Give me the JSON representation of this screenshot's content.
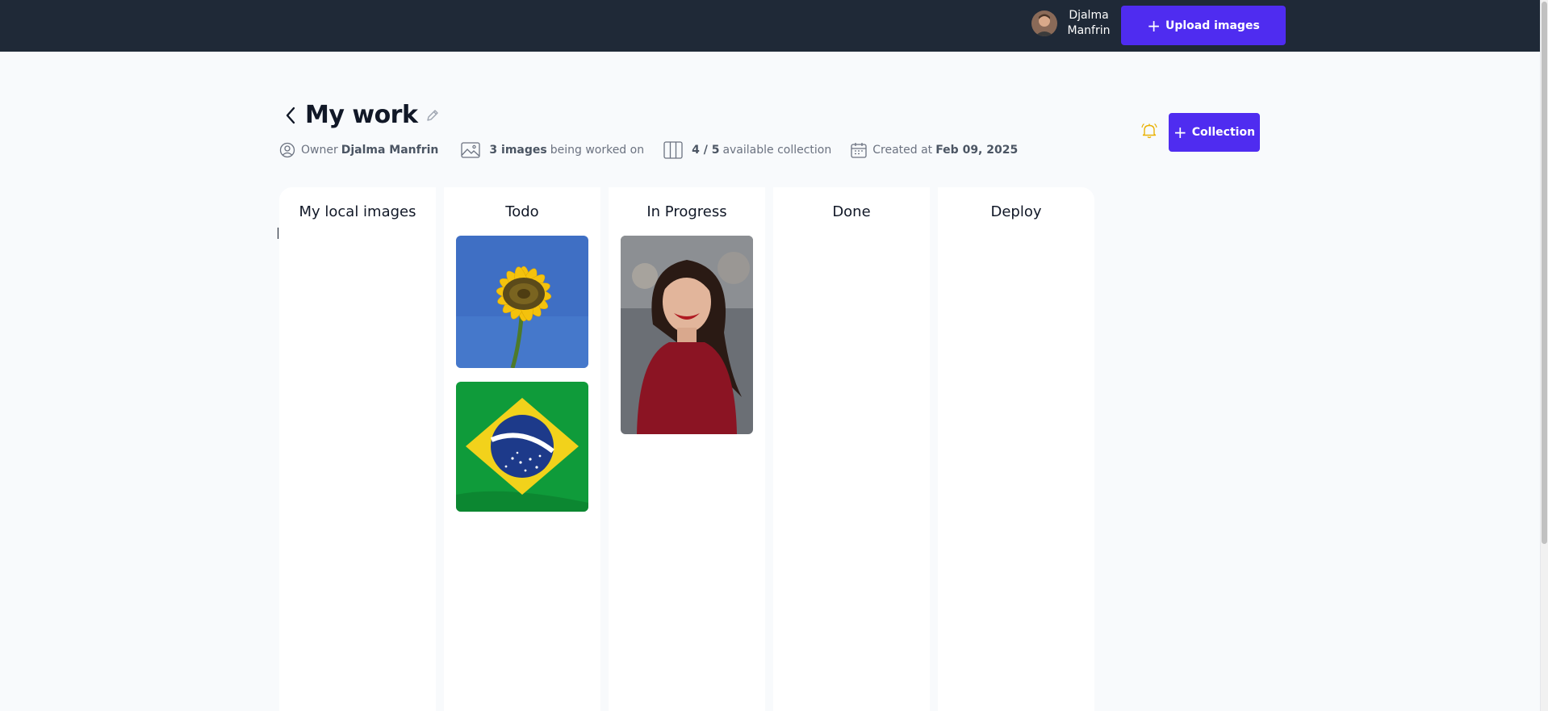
{
  "header": {
    "user": {
      "name": "Djalma\nManfrin",
      "avatar": "avatar-photo"
    },
    "upload_button": {
      "icon": "plus-icon",
      "label": "Upload images"
    }
  },
  "page": {
    "title": "My work",
    "meta": {
      "owner_label": "Owner",
      "owner_name": "Djalma Manfrin",
      "images_count": "3 images",
      "images_suffix": "being worked on",
      "collections_count": "4 / 5",
      "collections_suffix": "available collection",
      "created_label": "Created at",
      "created_date": "Feb 09, 2025"
    },
    "notification_icon": "bell-icon",
    "collection_button": {
      "icon": "plus-icon",
      "label": "Collection"
    }
  },
  "columns": [
    {
      "title": "My local images",
      "images": []
    },
    {
      "title": "Todo",
      "images": [
        "sunflower-photo",
        "brazil-flag-photo"
      ]
    },
    {
      "title": "In Progress",
      "images": [
        "smiling-woman-photo"
      ]
    },
    {
      "title": "Done",
      "images": []
    },
    {
      "title": "Deploy",
      "images": []
    }
  ],
  "colors": {
    "topbar": "#1f2937",
    "accent": "#4f2cf0",
    "background": "#f8fafc",
    "bell": "#eab308"
  }
}
